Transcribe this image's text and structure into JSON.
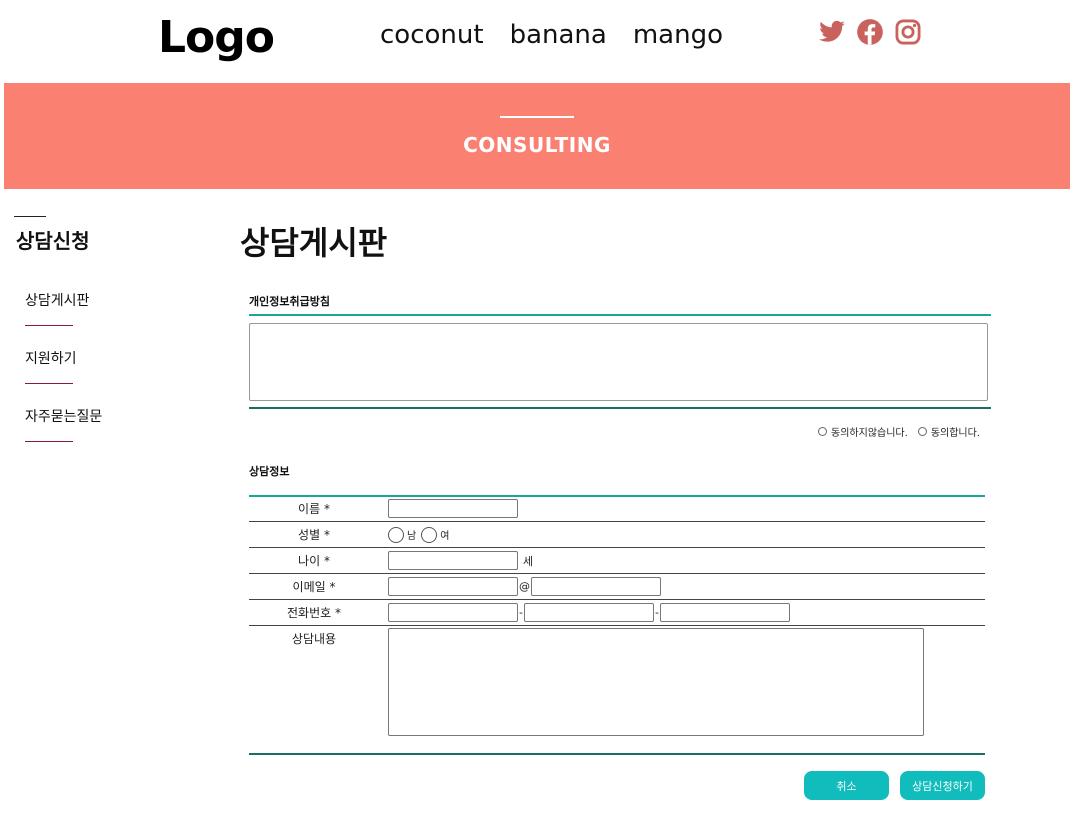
{
  "header": {
    "logo": "Logo",
    "nav": [
      "coconut",
      "banana",
      "mango"
    ],
    "social_icons": [
      "twitter-icon",
      "facebook-icon",
      "instagram-icon"
    ],
    "social_color": "#c9615c"
  },
  "banner": {
    "title": "CONSULTING",
    "color": "#fa8072"
  },
  "sidebar": {
    "title": "상담신청",
    "items": [
      {
        "label": "상담게시판"
      },
      {
        "label": "지원하기"
      },
      {
        "label": "자주묻는질문"
      }
    ]
  },
  "main": {
    "title": "상담게시판",
    "privacy_label": "개인정보취급방침",
    "agree": {
      "disagree": "동의하지않습니다.",
      "agree": "동의합니다."
    },
    "info_label": "상담정보",
    "form": {
      "name_label": "이름 *",
      "gender_label": "성별 *",
      "gender_male": "남",
      "gender_female": "여",
      "age_label": "나이 *",
      "age_unit": "세",
      "email_label": "이메일 *",
      "email_at": "@",
      "phone_label": "전화번호 *",
      "phone_sep": "-",
      "content_label": "상담내용"
    },
    "buttons": {
      "cancel": "취소",
      "submit": "상담신청하기"
    },
    "accent_color": "#11bcbc"
  }
}
